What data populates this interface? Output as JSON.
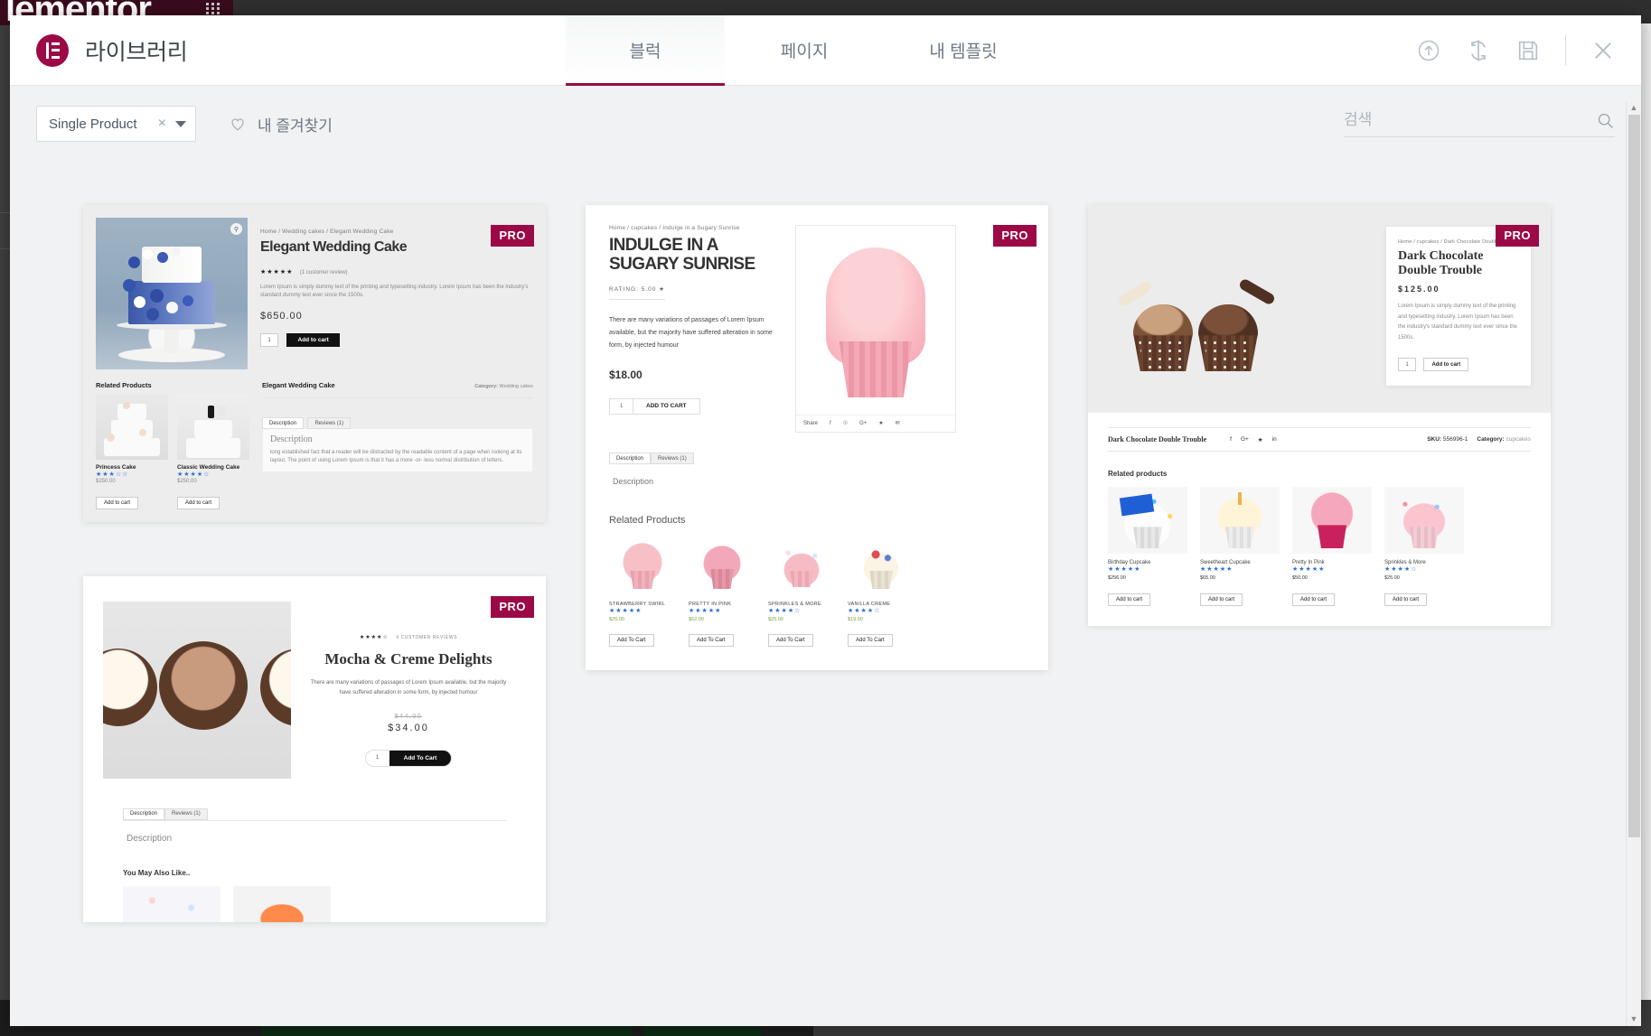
{
  "editor_background": {
    "logo_text": "lementor",
    "grid_icon": "apps-grid-icon"
  },
  "modal": {
    "title": "라이브러리",
    "logo_icon": "elementor-logo-icon",
    "tabs": [
      {
        "label": "블럭",
        "active": true
      },
      {
        "label": "페이지",
        "active": false
      },
      {
        "label": "내 템플릿",
        "active": false
      }
    ],
    "actions": [
      {
        "name": "upload-icon",
        "title": "Import Template"
      },
      {
        "name": "sync-icon",
        "title": "Sync Library"
      },
      {
        "name": "save-icon",
        "title": "Save"
      },
      {
        "name": "close-icon",
        "title": "Close"
      }
    ]
  },
  "filters": {
    "category": {
      "value": "Single Product",
      "clear_icon": "clear-x-icon",
      "caret_icon": "chevron-down-icon"
    },
    "favorites": {
      "label": "내 즐겨찾기",
      "icon": "heart-icon"
    },
    "search": {
      "placeholder": "검색",
      "value": "",
      "icon": "search-icon"
    }
  },
  "badges": {
    "pro": "PRO"
  },
  "templates": [
    {
      "id": "elegant-wedding-cake",
      "pro": true,
      "breadcrumb": "Home / Wedding cakes / Elegant Wedding Cake",
      "title": "Elegant Wedding Cake",
      "rating_stars": "★★★★★",
      "review_text": "(1 customer review)",
      "description": "Lorem Ipsum is simply dummy text of the printing and typesetting industry. Lorem Ipsum has been the industry's standard dummy text ever since the 1500s.",
      "price": "$650.00",
      "qty": "1",
      "add_to_cart": "Add to cart",
      "related_heading": "Related Products",
      "meta_title": "Elegant Wedding Cake",
      "meta_category_label": "Category:",
      "meta_category_value": "Wedding cakes",
      "tabs": [
        "Description",
        "Reviews (1)"
      ],
      "desc_heading": "Description",
      "desc_body": "long established fact that a reader will be distracted by the readable content of a page when looking at its layout. The point of using Lorem Ipsum is that it has a more -or- less normal distribution of letters.",
      "related": [
        {
          "name": "Princess Cake",
          "stars": "★★★☆☆",
          "price": "$250.00",
          "button": "Add to cart"
        },
        {
          "name": "Classic Wedding Cake",
          "stars": "★★★★☆",
          "price": "$250.00",
          "button": "Add to cart"
        }
      ]
    },
    {
      "id": "indulge-in-a-sugary-sunrise",
      "pro": true,
      "breadcrumb": "Home / cupcakes / Indulge in a Sugary Sunrise",
      "title": "INDULGE IN A SUGARY SUNRISE",
      "rating_label": "RATING:",
      "rating_value": "5.00",
      "rating_star": "★",
      "description": "There are many variations of passages of Lorem Ipsum available, but the majority have suffered alteration in some form, by injected humour",
      "price": "$18.00",
      "qty": "1",
      "add_to_cart": "ADD TO CART",
      "share_label": "Share",
      "share_icons": [
        "facebook-icon",
        "pinterest-icon",
        "googleplus-icon",
        "twitter-icon",
        "email-icon"
      ],
      "tabs": [
        "Description",
        "Reviews (1)"
      ],
      "desc_heading": "Description",
      "related_heading": "Related Products",
      "related": [
        {
          "name": "STRAWBERRY SWIRL",
          "stars": "★★★★★",
          "price": "$25.00",
          "button": "Add To Cart"
        },
        {
          "name": "PRETTY IN PINK",
          "stars": "★★★★★",
          "price": "$52.00",
          "button": "Add To Cart"
        },
        {
          "name": "SPRINKLES & MORE",
          "stars": "★★★★☆",
          "price": "$25.00",
          "button": "Add To Cart"
        },
        {
          "name": "VANILLA CREME",
          "stars": "★★★★☆",
          "price": "$19.00",
          "button": "Add To Cart"
        }
      ]
    },
    {
      "id": "dark-chocolate-double-trouble",
      "pro": true,
      "breadcrumb": "Home / cupcakes / Dark Chocolate Double Trouble",
      "title": "Dark Chocolate Double Trouble",
      "price": "$125.00",
      "description": "Lorem Ipsum is simply dummy text of the printing and typesetting industry. Lorem Ipsum has been the industry's standard dummy text ever since the 1500s.",
      "qty": "1",
      "add_to_cart": "Add to cart",
      "meta_title": "Dark Chocolate Double Trouble",
      "share_icons": [
        "facebook-icon",
        "googleplus-icon",
        "twitter-icon",
        "linkedin-icon"
      ],
      "sku_label": "SKU:",
      "sku_value": "556996-1",
      "category_label": "Category:",
      "category_value": "cupcakes",
      "related_heading": "Related products",
      "related": [
        {
          "name": "Birthday Cupcake",
          "stars": "★★★★★",
          "price": "$256.00",
          "button": "Add to cart"
        },
        {
          "name": "Sweetheart Cupcake",
          "stars": "★★★★★",
          "price": "$65.00",
          "button": "Add to cart"
        },
        {
          "name": "Pretty In Pink",
          "stars": "★★★★★",
          "price": "$50.00",
          "button": "Add to cart"
        },
        {
          "name": "Sprinkles & More",
          "stars": "★★★★☆",
          "price": "$25.00",
          "button": "Add to cart"
        }
      ]
    },
    {
      "id": "mocha-and-creme-delights",
      "pro": true,
      "stars": "★★★★☆",
      "review_text": "4 CUSTOMER REVIEWS",
      "title": "Mocha & Creme Delights",
      "description": "There are many variations of passages of Lorem Ipsum available, but the majority have suffered alteration in some form, by injected humour",
      "old_price": "$44.00",
      "price": "$34.00",
      "qty": "1",
      "add_to_cart": "Add To Cart",
      "tabs": [
        "Description",
        "Reviews (1)"
      ],
      "desc_heading": "Description",
      "alike_heading": "You May Also Like.."
    }
  ]
}
